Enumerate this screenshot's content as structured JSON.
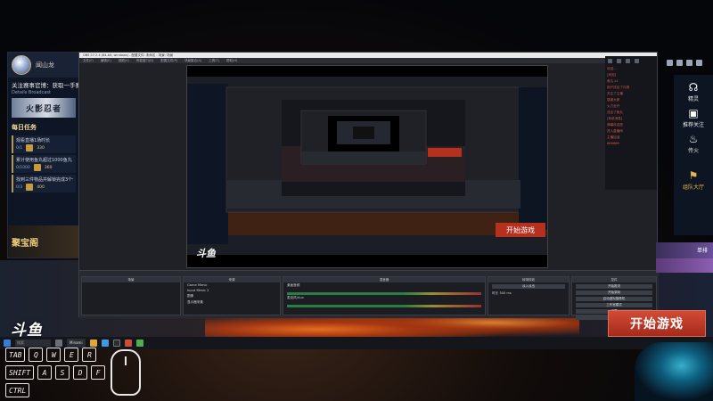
{
  "left_panel": {
    "streamer_name": "闻山龙",
    "notice": "关注赛事官博：获取一手赛事",
    "notice_sub": "Details  Broadcast",
    "banner_text": "火影忍者",
    "section_title": "每日任务",
    "tasks": [
      {
        "title": "观看直播1场时长",
        "progress": "0/1",
        "reward": "330"
      },
      {
        "title": "累计使用鱼丸超过1000鱼丸",
        "progress": "0/1000",
        "reward": "360"
      },
      {
        "title": "找到三件物品并解锁完成3个任务",
        "progress": "0/3",
        "reward": "400"
      }
    ],
    "store_label": "聚宝阁"
  },
  "obs": {
    "title": "OBS 27.2.4 (64-bit, windows) - 配置文件: 未命名 - 场景: 场景",
    "menu": [
      "文件(F)",
      "编辑(E)",
      "视图(V)",
      "停靠窗口(D)",
      "配置文件(P)",
      "场景集合(S)",
      "工具(T)",
      "帮助(H)"
    ],
    "docks": {
      "scenes_label": "场景",
      "sources_label": "来源",
      "mixer_label": "混音器",
      "transitions_label": "转场特效",
      "controls_label": "控件",
      "sources": [
        "Game Mimic",
        "Input Mimic 2",
        "图像",
        "显示器采集"
      ],
      "mixer_rows": [
        "桌面音频",
        "麦克风/Aux"
      ],
      "controls": [
        "开始推流",
        "开始录制",
        "启动虚拟摄像机",
        "工作室模式",
        "设置",
        "退出"
      ],
      "transition_value": "淡入淡出",
      "duration_label": "时长 300 ms"
    },
    "chat_lines": [
      "欢迎...",
      "[未知]",
      "鱼丸 x1",
      "用户送出了礼物",
      "关注了主播",
      "感谢大家",
      "火力全开",
      "送出了鱼丸",
      "[系统消息]",
      "弹幕欢迎您",
      "进入直播间",
      "主播加油",
      "666666"
    ]
  },
  "right_panel": {
    "buttons": [
      {
        "icon": "headset-icon",
        "glyph": "☊",
        "label": "精灵"
      },
      {
        "icon": "camera-icon",
        "glyph": "▣",
        "label": "推荐关注"
      },
      {
        "icon": "fire-icon",
        "glyph": "♨",
        "label": "传火"
      }
    ],
    "team": {
      "icon": "flag-icon",
      "glyph": "⚑",
      "label": "组队大厅"
    },
    "card_label": "单排"
  },
  "start_button_label": "开始游戏",
  "logo_text": "斗鱼",
  "taskbar": {
    "search": "搜索",
    "app_label": "Minami"
  },
  "keyboard": {
    "row1": [
      "TAB",
      "Q",
      "W",
      "E",
      "R"
    ],
    "row2": [
      "SHIFT",
      "A",
      "S",
      "D",
      "F"
    ],
    "row3": [
      "CTRL"
    ]
  },
  "colors": {
    "accent_red": "#c23a2e",
    "gold": "#e4b64b",
    "obs_bg": "#1f2127"
  }
}
